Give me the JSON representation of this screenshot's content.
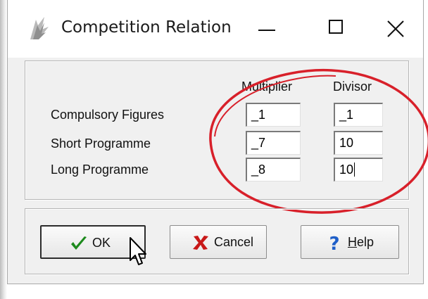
{
  "window": {
    "title": "Competition Relation"
  },
  "columns": {
    "multiplier": "Multiplier",
    "divisor": "Divisor"
  },
  "rows": [
    {
      "label": "Compulsory Figures",
      "multiplier": "_1",
      "divisor": "_1"
    },
    {
      "label": "Short Programme",
      "multiplier": "_7",
      "divisor": "10"
    },
    {
      "label": "Long Programme",
      "multiplier": "_8",
      "divisor": "10"
    }
  ],
  "buttons": {
    "ok": {
      "label": "OK",
      "icon": "checkmark-icon"
    },
    "cancel": {
      "label": "Cancel",
      "icon": "x-icon"
    },
    "help": {
      "label_accel": "H",
      "label_rest": "elp",
      "icon": "question-mark-icon"
    }
  },
  "colors": {
    "dialog_bg": "#f0f0f0",
    "annotation_circle": "#d8202a",
    "check_green": "#1d8a1d",
    "cancel_red": "#c81818",
    "help_blue": "#1f5fc8"
  }
}
